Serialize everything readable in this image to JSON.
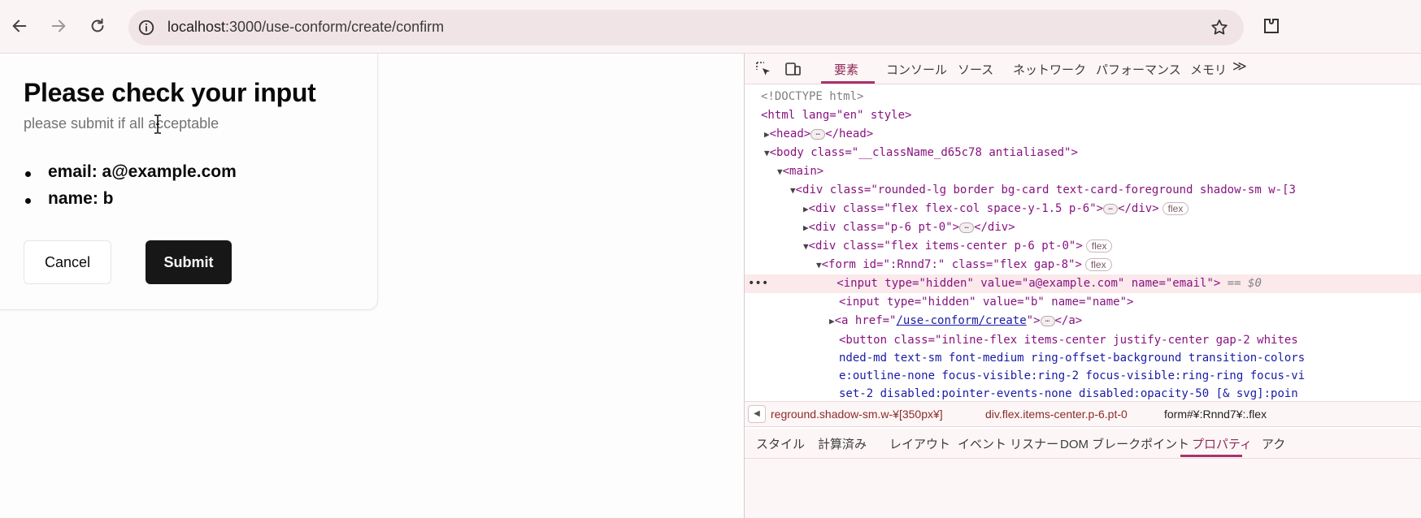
{
  "browser": {
    "url_host": "localhost",
    "url_rest": ":3000/use-conform/create/confirm"
  },
  "card": {
    "title": "Please check your input",
    "description": "please submit if all acceptable",
    "fields": [
      "email: a@example.com",
      "name: b"
    ],
    "cancel_label": "Cancel",
    "submit_label": "Submit"
  },
  "devtools": {
    "tabs": [
      "要素",
      "コンソール",
      "ソース",
      "ネットワーク",
      "パフォーマンス",
      "メモリ"
    ],
    "more_tabs": "≫",
    "dom": {
      "doctype": "<!DOCTYPE html>",
      "html_open": "<html lang=\"en\" style>",
      "head": "<head>",
      "head_close": "</head>",
      "body_open": "<body class=\"__className_d65c78 antialiased\">",
      "main_open": "<main>",
      "card_div": "<div class=\"rounded-lg border bg-card text-card-foreground shadow-sm w-[3",
      "header_div": "<div class=\"flex flex-col space-y-1.5 p-6\">",
      "content_div": "<div class=\"p-6 pt-0\">",
      "footer_div": "<div class=\"flex items-center p-6 pt-0\">",
      "form_open": "<form id=\":Rnnd7:\" class=\"flex gap-8\">",
      "input_email": "<input type=\"hidden\" value=\"a@example.com\" name=\"email\">",
      "eq_marker": "== $0",
      "input_name": "<input type=\"hidden\" value=\"b\" name=\"name\">",
      "anchor_open": "<a href=\"",
      "anchor_href": "/use-conform/create",
      "anchor_close": "\">",
      "anchor_end": "</a>",
      "button_1": "<button class=\"inline-flex items-center justify-center gap-2 whites",
      "button_2": "nded-md text-sm font-medium ring-offset-background transition-colors",
      "button_3": "e:outline-none focus-visible:ring-2 focus-visible:ring-ring focus-vi",
      "button_4": "set-2 disabled:pointer-events-none disabled:opacity-50 [& svg]:poin",
      "div_close": "</div>",
      "flex_badge": "flex",
      "ellipsis": "…",
      "row_menu": "•••"
    },
    "breadcrumbs": [
      "reground.shadow-sm.w-¥[350px¥]",
      "div.flex.items-center.p-6.pt-0",
      "form#¥:Rnnd7¥:.flex"
    ],
    "sub_tabs": [
      "スタイル",
      "計算済み",
      "レイアウト",
      "イベント リスナー",
      "DOM ブレークポイント",
      "プロパティ",
      "アク"
    ]
  }
}
